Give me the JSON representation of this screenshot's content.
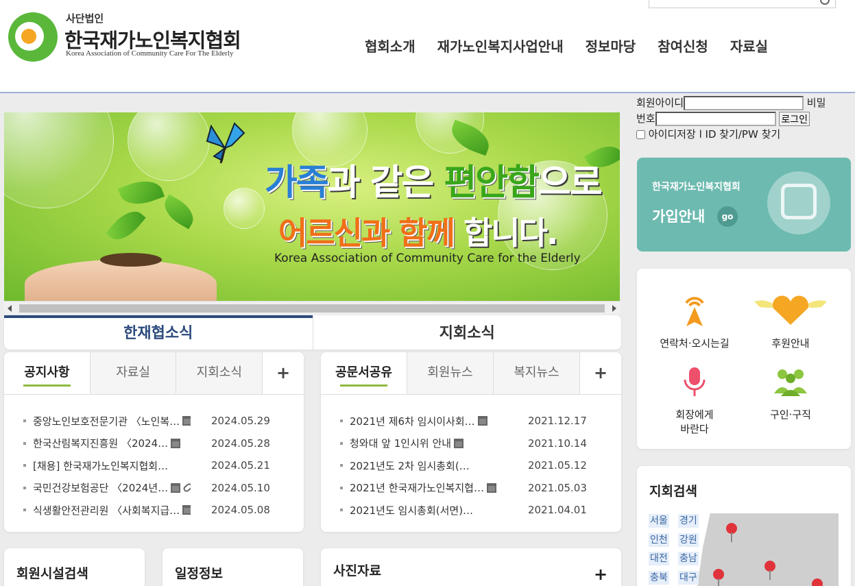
{
  "header": {
    "logo_sub": "사단법인",
    "logo_title": "한국재가노인복지협회",
    "logo_eng": "Korea Association of Community Care For The Elderly",
    "nav": [
      "협회소개",
      "재가노인복지사업안내",
      "정보마당",
      "참여신청",
      "자료실"
    ]
  },
  "login": {
    "id_label": "회원아이디",
    "pw_label_1": "비밀",
    "pw_label_2": "번호",
    "login_button": "로그인",
    "remember_label": "아이디저장",
    "find_label": "ID 찾기/PW 찾기",
    "separator": "l"
  },
  "banner": {
    "line1_a": "가족",
    "line1_b": "과 같은 ",
    "line1_c": "편안함",
    "line1_d": "으로",
    "line2_a": "어르신과 ",
    "line2_b": "함께",
    "line2_c": " 합니다.",
    "eng": "Korea Association of Community Care for the Elderly"
  },
  "main_tabs": [
    "한재협소식",
    "지회소식"
  ],
  "notice_box": {
    "tabs": [
      "공지사항",
      "자료실",
      "지회소식"
    ],
    "plus": "+",
    "items": [
      {
        "title": "중앙노인보호전문기관 〈노인복…",
        "date": "2024.05.29",
        "file": true,
        "link": false
      },
      {
        "title": "한국산림복지진흥원 〈2024…",
        "date": "2024.05.28",
        "file": true,
        "link": false
      },
      {
        "title": "[채용] 한국재가노인복지협회…",
        "date": "2024.05.21",
        "file": false,
        "link": false
      },
      {
        "title": "국민건강보험공단 〈2024년…",
        "date": "2024.05.10",
        "file": true,
        "link": true
      },
      {
        "title": "식생활안전관리원 〈사회복지급…",
        "date": "2024.05.08",
        "file": true,
        "link": false
      }
    ]
  },
  "doc_box": {
    "tabs": [
      "공문서공유",
      "회원뉴스",
      "복지뉴스"
    ],
    "plus": "+",
    "items": [
      {
        "title": "2021년 제6차 임시이사회…",
        "date": "2021.12.17",
        "file": true
      },
      {
        "title": "청와대 앞 1인시위 안내",
        "date": "2021.10.14",
        "file": true
      },
      {
        "title": "2021년도 2차 임시총회(…",
        "date": "2021.05.12",
        "file": false
      },
      {
        "title": "2021년 한국재가노인복지협…",
        "date": "2021.05.03",
        "file": true
      },
      {
        "title": "2021년도 임시총회(서면)…",
        "date": "2021.04.01",
        "file": false
      }
    ]
  },
  "bottom": {
    "facility_search": "회원시설검색",
    "schedule": "일정정보",
    "photo": "사진자료",
    "plus": "+"
  },
  "join": {
    "sub": "한국재가노인복지협회",
    "big": "가입안내",
    "go": "go"
  },
  "quick": {
    "contact": "연락처·오시는길",
    "donate": "후원안내",
    "to_president_1": "회장에게",
    "to_president_2": "바란다",
    "jobs": "구인·구직"
  },
  "branch": {
    "title": "지회검색",
    "regions": [
      "서울",
      "경기",
      "인천",
      "강원",
      "대전",
      "충남",
      "충북",
      "대구"
    ]
  },
  "colors": {
    "accent_navy": "#2c4a7d",
    "tab_underline": "#8dbb3e",
    "join_teal": "#6dbab0",
    "logo_green": "#5ab73a"
  }
}
